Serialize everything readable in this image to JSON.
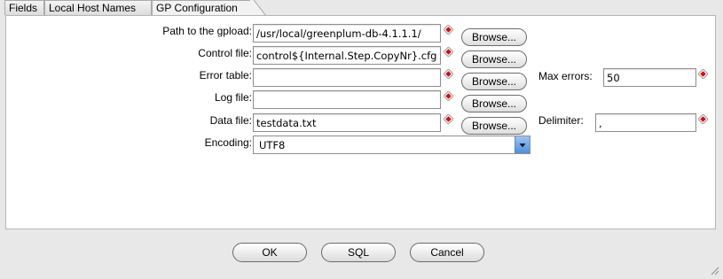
{
  "tabs": [
    {
      "label": "Fields",
      "active": false
    },
    {
      "label": "Local Host Names",
      "active": false
    },
    {
      "label": "GP Configuration",
      "active": true
    }
  ],
  "form": {
    "gpload_label": "Path to the gpload:",
    "gpload_value": "/usr/local/greenplum-db-4.1.1.1/",
    "control_label": "Control file:",
    "control_value": "control${Internal.Step.CopyNr}.cfg",
    "error_table_label": "Error table:",
    "error_table_value": "",
    "log_label": "Log file:",
    "log_value": "",
    "data_label": "Data file:",
    "data_value": "testdata.txt",
    "encoding_label": "Encoding:",
    "encoding_value": "UTF8",
    "max_errors_label": "Max errors:",
    "max_errors_value": "50",
    "delimiter_label": "Delimiter:",
    "delimiter_value": ",",
    "browse_label": "Browse..."
  },
  "buttons": {
    "ok": "OK",
    "sql": "SQL",
    "cancel": "Cancel"
  },
  "colors": {
    "warning_icon": "#d01010",
    "select_accent": "#4d8fdc"
  }
}
